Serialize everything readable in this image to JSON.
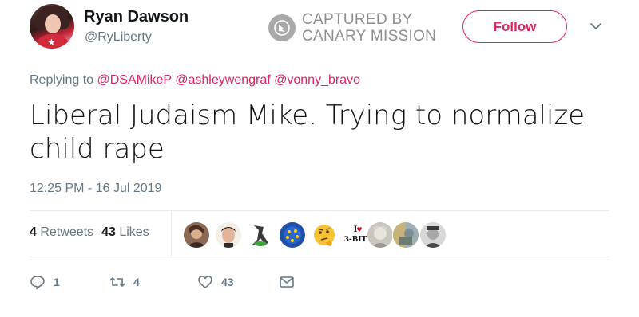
{
  "author": {
    "display_name": "Ryan Dawson",
    "handle": "@RyLiberty",
    "follow_label": "Follow"
  },
  "watermark": {
    "line1": "CAPTURED BY",
    "line2": "CANARY MISSION"
  },
  "reply": {
    "prefix": "Replying to",
    "mentions": [
      "@DSAMikeP",
      "@ashleywengraf",
      "@vonny_bravo"
    ]
  },
  "tweet": {
    "text": "Liberal Judaism Mike. Trying to normalize child rape",
    "timestamp": "12:25 PM - 16 Jul 2019"
  },
  "stats": {
    "retweets_count": "4",
    "retweets_label": "Retweets",
    "likes_count": "43",
    "likes_label": "Likes"
  },
  "likers": [
    {
      "name": "liker-avatar-1",
      "color": "#6b4a3a"
    },
    {
      "name": "liker-avatar-2",
      "color": "#c8a08a"
    },
    {
      "name": "liker-avatar-3",
      "color": "#4b8f3a"
    },
    {
      "name": "liker-avatar-4",
      "color": "#2a5fb8"
    },
    {
      "name": "liker-avatar-5",
      "color": "#f2b824"
    },
    {
      "name": "liker-avatar-6",
      "color": "#ffffff"
    },
    {
      "name": "liker-avatar-7",
      "color": "#b9b6ad"
    },
    {
      "name": "liker-avatar-8",
      "color": "#8aa0a8"
    },
    {
      "name": "liker-avatar-9",
      "color": "#6e6e6e"
    }
  ],
  "liker6_text": "I ♥ 3-BIT",
  "actions": {
    "reply_count": "1",
    "retweet_count": "4",
    "like_count": "43"
  },
  "colors": {
    "accent": "#e0245e",
    "secondary_text": "#657786",
    "primary_text": "#14171a"
  }
}
